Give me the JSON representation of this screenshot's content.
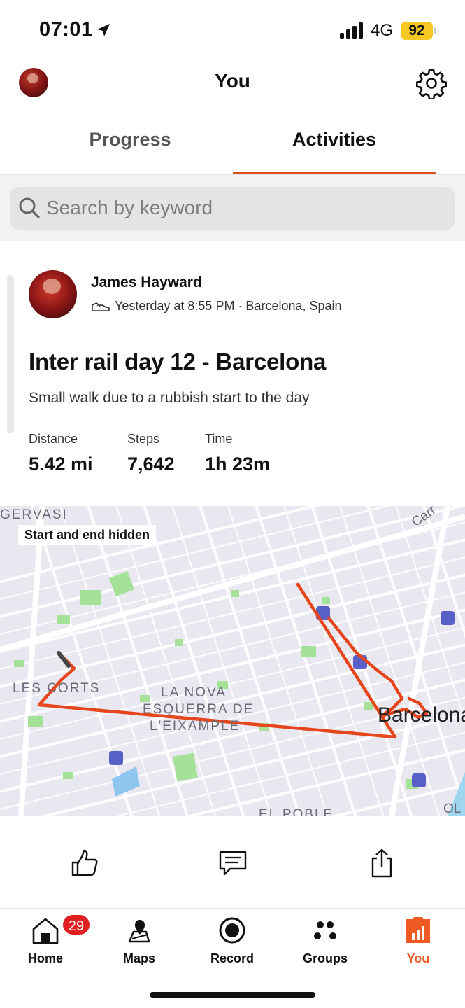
{
  "status_bar": {
    "time": "07:01",
    "network": "4G",
    "battery": "92"
  },
  "header": {
    "title": "You",
    "avatar": "profile-avatar",
    "settings_icon": "gear-icon"
  },
  "tabs": [
    {
      "label": "Progress",
      "active": false
    },
    {
      "label": "Activities",
      "active": true
    }
  ],
  "search": {
    "placeholder": "Search by keyword",
    "value": ""
  },
  "activity": {
    "athlete": "James Hayward",
    "meta": "Yesterday at 8:55 PM · Barcelona, Spain",
    "title": "Inter rail day 12 - Barcelona",
    "description": "Small walk due to a rubbish start to the day",
    "stats": [
      {
        "label": "Distance",
        "value": "5.42 mi"
      },
      {
        "label": "Steps",
        "value": "7,642"
      },
      {
        "label": "Time",
        "value": "1h 23m"
      }
    ],
    "map": {
      "badge": "Start and end hidden",
      "labels": [
        "GERVASI",
        "LES CORTS",
        "LA NOVA",
        "ESQUERRA DE",
        "L'EIXAMPLE",
        "Barcelona",
        "Carr",
        "EL POBLE",
        "OL"
      ],
      "route_color": "#e5461b"
    }
  },
  "actions": [
    "thumbs-up-icon",
    "comment-icon",
    "share-icon"
  ],
  "bottom_nav": [
    {
      "label": "Home",
      "icon": "home-icon",
      "badge": "29",
      "active": false
    },
    {
      "label": "Maps",
      "icon": "map-pin-icon",
      "active": false
    },
    {
      "label": "Record",
      "icon": "record-icon",
      "active": false
    },
    {
      "label": "Groups",
      "icon": "groups-icon",
      "active": false
    },
    {
      "label": "You",
      "icon": "you-icon",
      "active": true
    }
  ],
  "colors": {
    "accent": "#e04d1c",
    "badge": "#e02020",
    "battery": "#f7c824"
  }
}
